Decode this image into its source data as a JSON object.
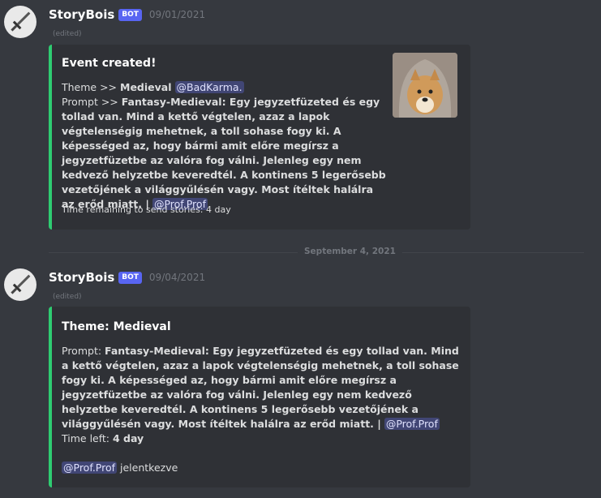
{
  "messages": [
    {
      "username": "StoryBois",
      "bot_tag": "BOT",
      "timestamp": "09/01/2021",
      "edited": "(edited)",
      "embed": {
        "title": "Event created!",
        "theme_prefix": "Theme >> ",
        "theme_value": "Medieval",
        "theme_mention": "@BadKarma.",
        "prompt_prefix": "Prompt >> ",
        "prompt_text": "Fantasy-Medieval: Egy jegyzetfüzeted és egy tollad van. Mind a kettő végtelen, azaz a lapok végtelenségig mehetnek, a toll sohase fogy ki. A képességed az, hogy bármi amit előre megírsz a jegyzetfüzetbe az valóra fog válni. Jelenleg egy nem kedvező helyzetbe keveredtél. A kontinens 5 legerősebb vezetőjének a világgyűlésén vagy. Most ítéltek halálra az erőd miatt. |",
        "prompt_mention": "@Prof.Prof",
        "footer": "Time remaining to send stories: 4 day",
        "thumbnail_icon": "hooded-dog-photo"
      }
    },
    {
      "username": "StoryBois",
      "bot_tag": "BOT",
      "timestamp": "09/04/2021",
      "edited": "(edited)",
      "embed": {
        "title": "Theme: Medieval",
        "prompt_prefix": "Prompt: ",
        "prompt_text": "Fantasy-Medieval: Egy jegyzetfüzeted és egy tollad van. Mind a kettő végtelen, azaz a lapok végtelenségig mehetnek, a toll sohase fogy ki. A képességed az, hogy bármi amit előre megírsz a jegyzetfüzetbe az valóra fog válni. Jelenleg egy nem kedvező helyzetbe keveredtél. A kontinens 5 legerősebb vezetőjének a világgyűlésén vagy. Most ítéltek halálra az erőd miatt. |",
        "prompt_mention": "@Prof.Prof",
        "time_left_prefix": "Time left: ",
        "time_left_value": "4 day",
        "signup_mention": "@Prof.Prof",
        "signup_text": " jelentkezve"
      }
    }
  ],
  "date_divider": "September 4, 2021",
  "colors": {
    "background": "#36393f",
    "embed_bg": "#2f3136",
    "embed_accent": "#2ecc71",
    "bot_tag": "#5865f2",
    "mention_bg": "#414675"
  },
  "avatar_icon": "sword-icon"
}
